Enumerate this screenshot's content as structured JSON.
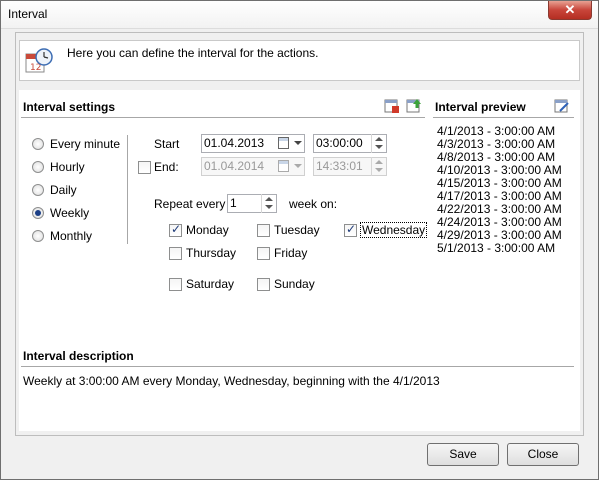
{
  "window": {
    "title": "Interval",
    "close_glyph": "✕"
  },
  "header": {
    "text": "Here you can define the interval for the actions.",
    "icon": "calendar-clock-icon"
  },
  "interval_settings": {
    "title": "Interval settings",
    "icons": [
      "calendar-red-icon",
      "calendar-green-icon"
    ],
    "frequency_options": [
      {
        "label": "Every minute",
        "selected": false
      },
      {
        "label": "Hourly",
        "selected": false
      },
      {
        "label": "Daily",
        "selected": false
      },
      {
        "label": "Weekly",
        "selected": true
      },
      {
        "label": "Monthly",
        "selected": false
      }
    ],
    "start": {
      "label": "Start",
      "date": "01.04.2013",
      "time": "03:00:00"
    },
    "end": {
      "label": "End:",
      "checked": false,
      "date": "01.04.2014",
      "time": "14:33:01"
    },
    "repeat": {
      "prefix": "Repeat every",
      "value": "1",
      "suffix": "week on:"
    },
    "days": [
      {
        "label": "Monday",
        "checked": true
      },
      {
        "label": "Tuesday",
        "checked": false
      },
      {
        "label": "Wednesday",
        "checked": true
      },
      {
        "label": "Thursday",
        "checked": false
      },
      {
        "label": "Friday",
        "checked": false
      },
      {
        "label": "Saturday",
        "checked": false
      },
      {
        "label": "Sunday",
        "checked": false
      }
    ]
  },
  "interval_preview": {
    "title": "Interval preview",
    "icon": "calendar-edit-icon",
    "items": [
      "4/1/2013 - 3:00:00 AM",
      "4/3/2013 - 3:00:00 AM",
      "4/8/2013 - 3:00:00 AM",
      "4/10/2013 - 3:00:00 AM",
      "4/15/2013 - 3:00:00 AM",
      "4/17/2013 - 3:00:00 AM",
      "4/22/2013 - 3:00:00 AM",
      "4/24/2013 - 3:00:00 AM",
      "4/29/2013 - 3:00:00 AM",
      "5/1/2013 - 3:00:00 AM"
    ]
  },
  "interval_description": {
    "title": "Interval description",
    "text": "Weekly at 3:00:00 AM every Monday, Wednesday, beginning with the 4/1/2013"
  },
  "buttons": {
    "save": "Save",
    "close": "Close"
  }
}
